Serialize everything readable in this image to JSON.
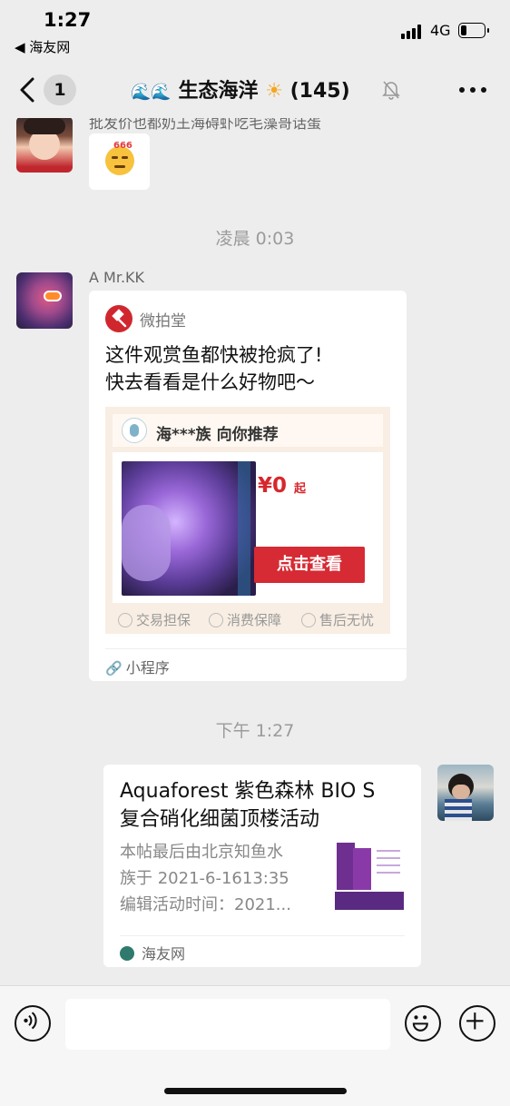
{
  "status": {
    "time": "1:27",
    "back_app": "◀ 海友网",
    "network": "4G",
    "battery_percent": 25
  },
  "nav": {
    "unread": "1",
    "title_emoji": "🌊🌊",
    "title_text": "生态海洋",
    "title_sun": "☀",
    "member_count": "(145)"
  },
  "messages": {
    "prev_cut_text": "批发价也都奶王海碍虾吃毛藻哥话蛋",
    "sticker_text": "666",
    "timestamp_1": "凌晨 0:03",
    "sender_name": "A  Mr.KK",
    "miniprogram": {
      "app_name": "微拍堂",
      "title_line1": "这件观赏鱼都快被抢疯了!",
      "title_line2": "快去看看是什么好物吧～",
      "preview_header": "海***族 向你推荐",
      "price": "¥0",
      "price_suffix": "起",
      "button": "点击查看",
      "guarantees": [
        "交易担保",
        "消费保障",
        "售后无忧"
      ],
      "footer": "小程序"
    },
    "timestamp_2": "下午 1:27",
    "article": {
      "title_line1": "Aquaforest 紫色森林 BIO S",
      "title_line2": "复合硝化细菌顶楼活动",
      "desc_line1": "本帖最后由北京知鱼水",
      "desc_line2": "族于 2021-6-1613:35",
      "desc_line3": "编辑活动时间：2021...",
      "source": "海友网"
    }
  },
  "colors": {
    "background": "#ededed",
    "price_red": "#d8262d",
    "button_red": "#d62b34"
  }
}
